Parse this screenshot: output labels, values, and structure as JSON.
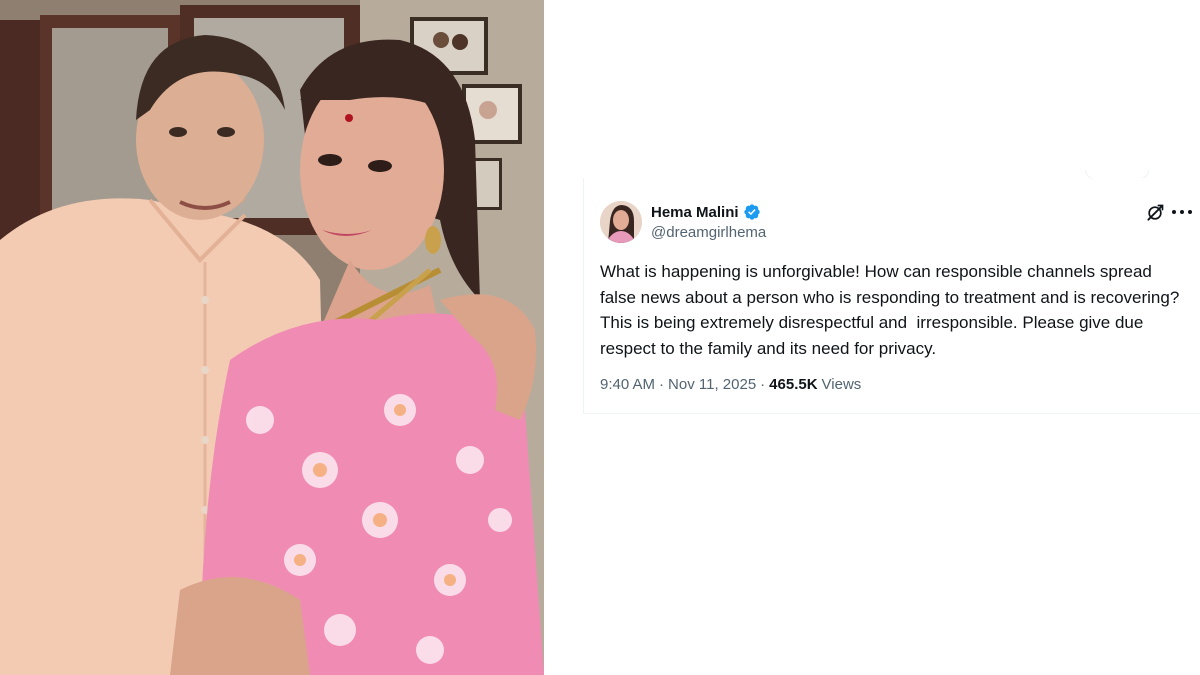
{
  "tweet": {
    "author_name": "Hema Malini",
    "author_handle": "@dreamgirlhema",
    "verified": true,
    "text": "What is happening is unforgivable! How can responsible channels spread false news about a person who is responding to treatment and is recovering? This is being extremely disrespectful and  irresponsible. Please give due respect to the family and its need for privacy.",
    "time": "9:40 AM",
    "separator": "·",
    "date": "Nov 11, 2025",
    "views_count": "465.5K",
    "views_label": "Views"
  },
  "icons": {
    "verified": "verified-badge-icon",
    "grok": "grok-icon",
    "more": "more-options-icon"
  },
  "colors": {
    "text_primary": "#0f1419",
    "text_secondary": "#536471",
    "verified_blue": "#1d9bf0",
    "border": "#eff3f4",
    "shirt_peach": "#f3cbb3",
    "saree_pink": "#f08cb4"
  }
}
